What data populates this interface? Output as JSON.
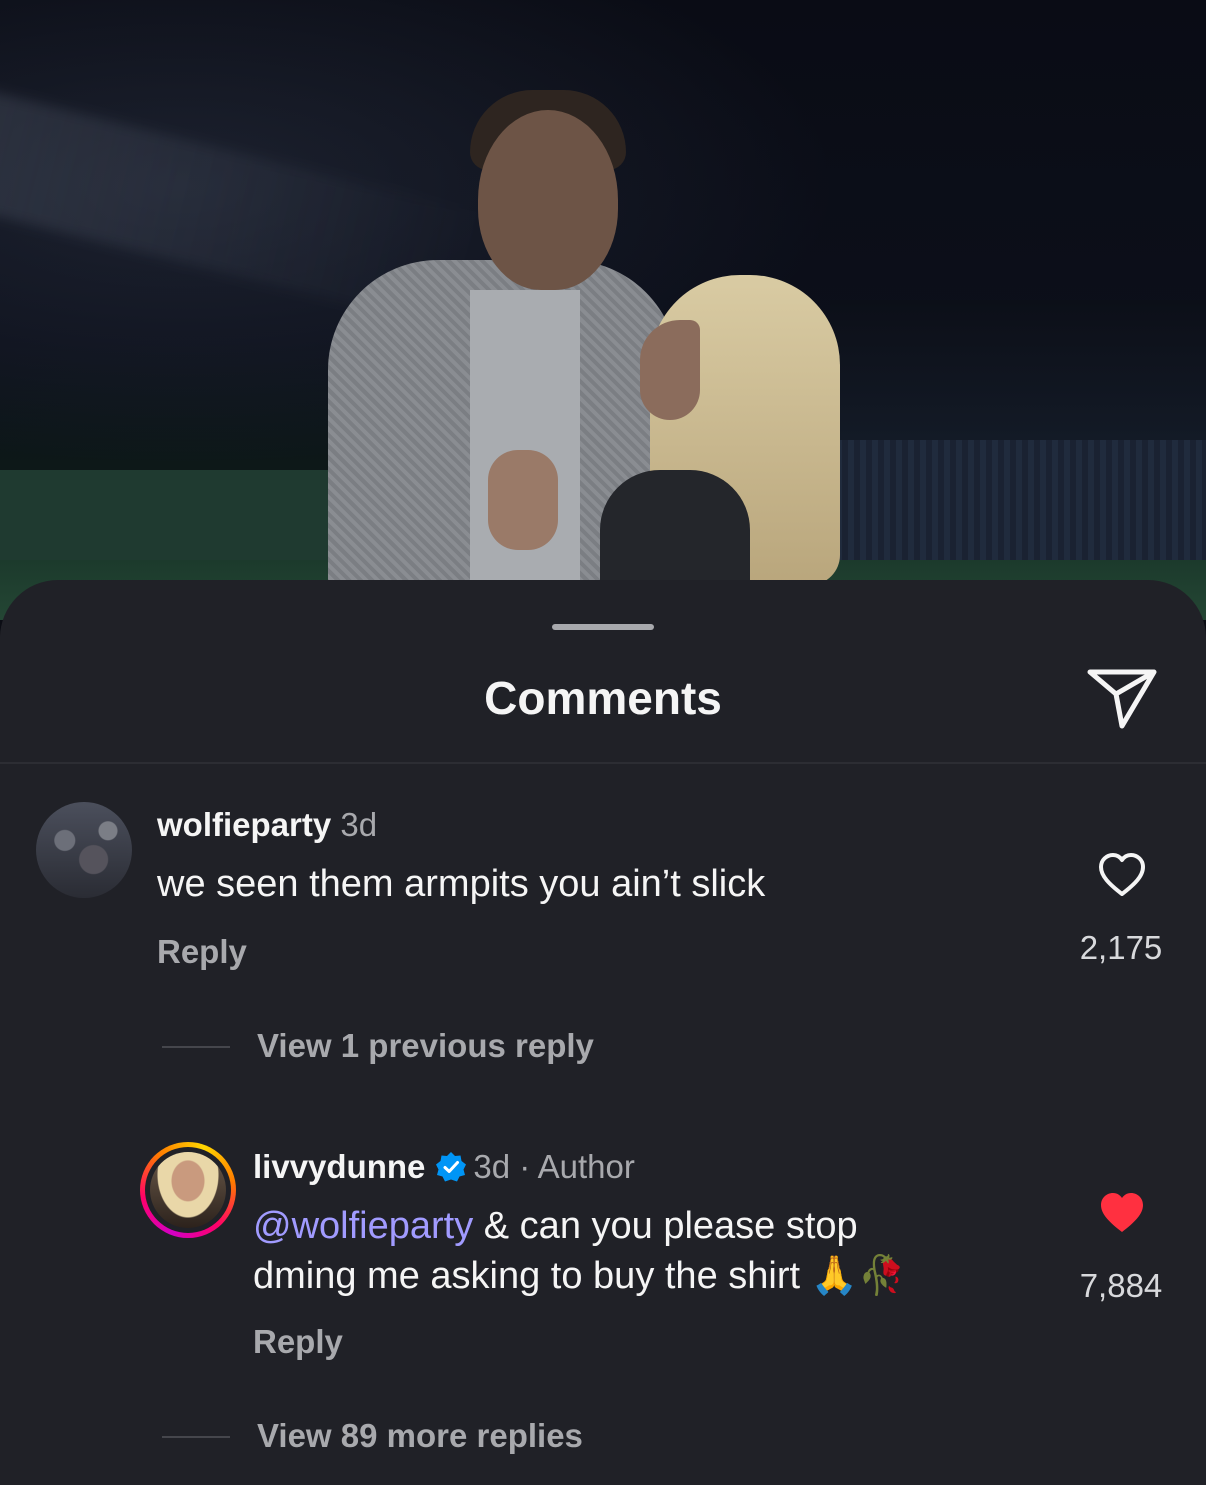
{
  "sheet": {
    "title": "Comments"
  },
  "comments": [
    {
      "username": "wolfieparty",
      "time": "3d",
      "text": "we seen them armpits you ain’t slick",
      "reply_label": "Reply",
      "likes": "2,175",
      "liked": false,
      "view_replies": "View 1 previous reply"
    },
    {
      "username": "livvydunne",
      "verified": true,
      "time": "3d",
      "separator": "·",
      "badge": "Author",
      "mention": "@wolfieparty",
      "text_line1": " & can you please stop",
      "text_line2": "dming me asking to buy the shirt",
      "emojis": "🙏🥀",
      "reply_label": "Reply",
      "likes": "7,884",
      "liked": true,
      "view_replies": "View 89 more replies"
    }
  ],
  "colors": {
    "sheet_bg": "#202127",
    "mention": "#a19bff",
    "like_active": "#ff3040",
    "verified": "#0095f6",
    "muted_text": "#a8a9ad"
  },
  "icons": {
    "share": "paper-plane-icon",
    "like": "heart-icon",
    "verified": "verified-badge-icon"
  }
}
